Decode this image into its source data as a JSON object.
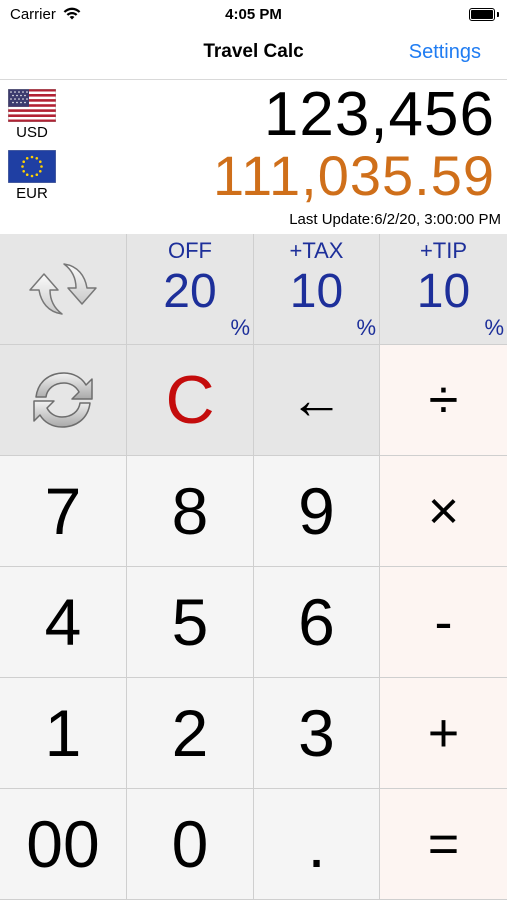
{
  "status_bar": {
    "carrier": "Carrier",
    "time": "4:05 PM"
  },
  "nav": {
    "title": "Travel Calc",
    "settings_label": "Settings"
  },
  "display": {
    "base_currency": "USD",
    "target_currency": "EUR",
    "input_value": "123,456",
    "converted_value": "111,035.59",
    "last_update": "Last Update:6/2/20, 3:00:00 PM",
    "converted_color": "#cf6f1a"
  },
  "percent_keys": [
    {
      "label": "OFF",
      "value": "20",
      "sign": "%"
    },
    {
      "label": "+TAX",
      "value": "10",
      "sign": "%"
    },
    {
      "label": "+TIP",
      "value": "10",
      "sign": "%"
    }
  ],
  "keys": {
    "clear": "C",
    "backspace": "←",
    "divide": "÷",
    "multiply": "×",
    "subtract": "-",
    "add": "+",
    "equals": "=",
    "seven": "7",
    "eight": "8",
    "nine": "9",
    "four": "4",
    "five": "5",
    "six": "6",
    "one": "1",
    "two": "2",
    "three": "3",
    "double_zero": "00",
    "zero": "0",
    "decimal": "."
  },
  "icons": {
    "swap": "swap-arrows-icon",
    "refresh": "refresh-rates-icon",
    "flag_usd": "us-flag-icon",
    "flag_eur": "eu-flag-icon"
  },
  "colors": {
    "accent": "#1f7cf2",
    "percent": "#1d2f9a",
    "clear": "#c40c0c"
  }
}
